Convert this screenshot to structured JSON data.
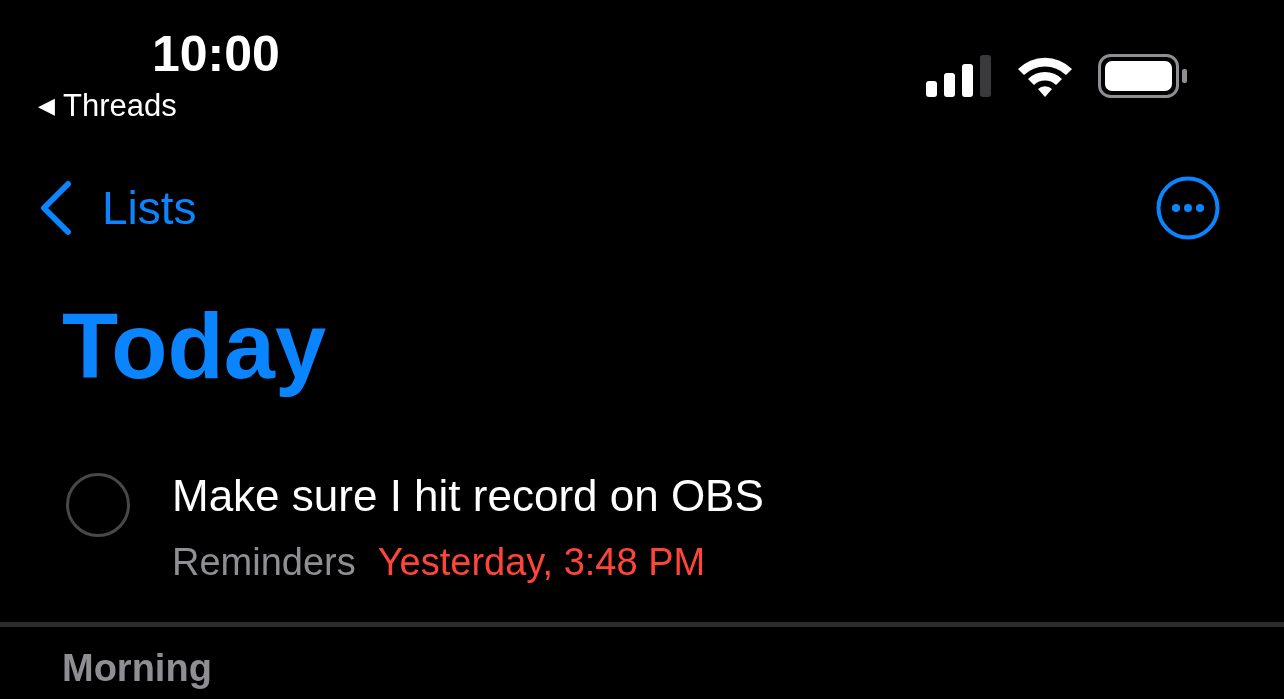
{
  "status_bar": {
    "time": "10:00",
    "back_glyph": "◀",
    "back_app": "Threads"
  },
  "nav": {
    "back_label": "Lists"
  },
  "title": "Today",
  "reminders": [
    {
      "title": "Make sure I hit record on OBS",
      "list": "Reminders",
      "due": "Yesterday, 3:48 PM",
      "completed": false,
      "overdue": true
    }
  ],
  "sections": [
    {
      "title": "Morning"
    }
  ]
}
